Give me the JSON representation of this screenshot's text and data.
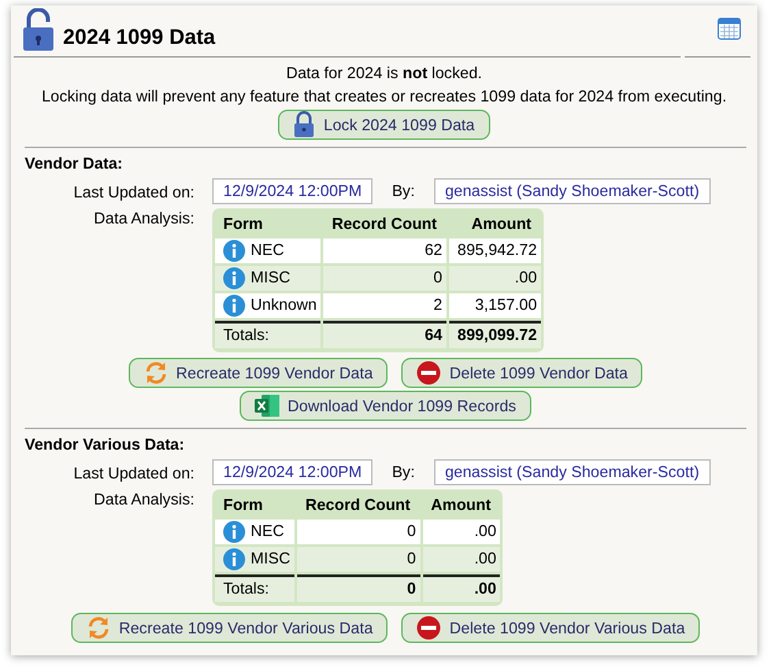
{
  "header": {
    "title": "2024 1099 Data"
  },
  "status": {
    "message": "Data for 2024 is **not** locked.",
    "note": "Locking data will prevent any feature that creates or recreates 1099 data for 2024 from executing.",
    "button": {
      "label": "Lock 2024 1099 Data",
      "kind": "lock"
    }
  },
  "sections": [
    {
      "title": "Vendor Data:",
      "updated_label": "Last Updated on:",
      "updated": "12/9/2024 12:00PM",
      "by_label": "By:",
      "by": "genassist (Sandy Shoemaker-Scott)",
      "analysis_label": "Data Analysis:",
      "columns": [
        "Form",
        "Record Count",
        "Amount"
      ],
      "rows": [
        {
          "form": "NEC",
          "count": "62",
          "amount": "895,942.72"
        },
        {
          "form": "MISC",
          "count": "0",
          "amount": ".00"
        },
        {
          "form": "Unknown",
          "count": "2",
          "amount": "3,157.00"
        }
      ],
      "totals": {
        "label": "Totals:",
        "count": "64",
        "amount": "899,099.72"
      },
      "buttons": [
        [
          {
            "label": "Recreate 1099 Vendor Data",
            "kind": "recreate"
          },
          {
            "label": "Delete 1099 Vendor Data",
            "kind": "delete"
          }
        ],
        [
          {
            "label": "Download Vendor 1099 Records",
            "kind": "download"
          }
        ]
      ]
    },
    {
      "title": "Vendor Various Data:",
      "updated_label": "Last Updated on:",
      "updated": "12/9/2024 12:00PM",
      "by_label": "By:",
      "by": "genassist (Sandy Shoemaker-Scott)",
      "analysis_label": "Data Analysis:",
      "columns": [
        "Form",
        "Record Count",
        "Amount"
      ],
      "rows": [
        {
          "form": "NEC",
          "count": "0",
          "amount": ".00"
        },
        {
          "form": "MISC",
          "count": "0",
          "amount": ".00"
        }
      ],
      "totals": {
        "label": "Totals:",
        "count": "0",
        "amount": ".00"
      },
      "buttons": [
        [
          {
            "label": "Recreate 1099 Vendor Various Data",
            "kind": "recreate"
          },
          {
            "label": "Delete 1099 Vendor Various Data",
            "kind": "delete"
          }
        ]
      ]
    }
  ]
}
